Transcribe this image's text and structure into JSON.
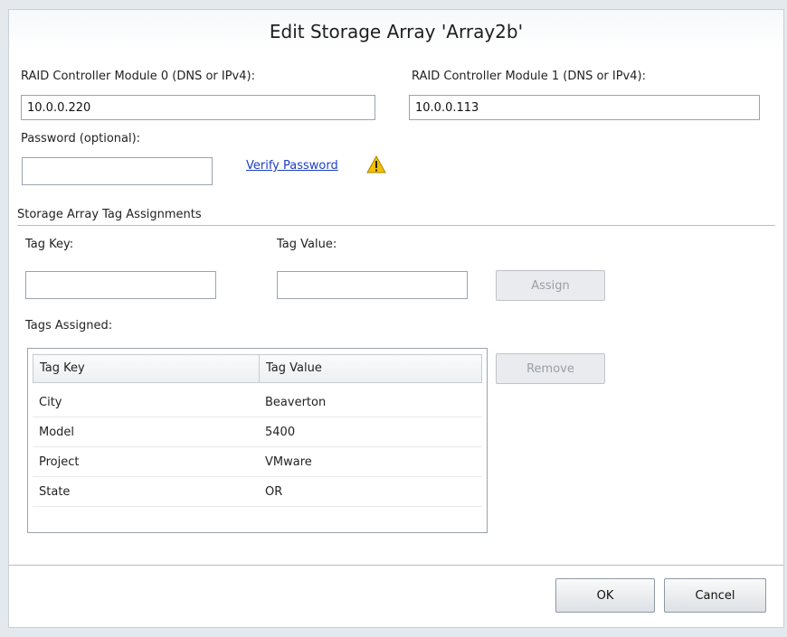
{
  "dialog": {
    "title": "Edit Storage Array 'Array2b'"
  },
  "controller0": {
    "label": "RAID Controller Module 0 (DNS or IPv4):",
    "value": "10.0.0.220"
  },
  "controller1": {
    "label": "RAID Controller Module 1 (DNS or IPv4):",
    "value": "10.0.0.113"
  },
  "password": {
    "label": "Password (optional):",
    "value": "",
    "verify_link": "Verify Password",
    "warning_icon": "warning-triangle-icon"
  },
  "tags": {
    "section_title": "Storage Array Tag Assignments",
    "key_label": "Tag Key:",
    "value_label": "Tag Value:",
    "key_value": "",
    "value_value": "",
    "assign_button": "Assign",
    "assigned_label": "Tags Assigned:",
    "remove_button": "Remove",
    "columns": [
      "Tag Key",
      "Tag Value"
    ],
    "rows": [
      {
        "key": "City",
        "value": "Beaverton"
      },
      {
        "key": "Model",
        "value": "5400"
      },
      {
        "key": "Project",
        "value": "VMware"
      },
      {
        "key": "State",
        "value": "OR"
      }
    ]
  },
  "footer": {
    "ok_button": "OK",
    "cancel_button": "Cancel"
  },
  "colors": {
    "link": "#1d3fc3",
    "warning": "#f2c100",
    "disabled_text": "#9aa0a6"
  }
}
